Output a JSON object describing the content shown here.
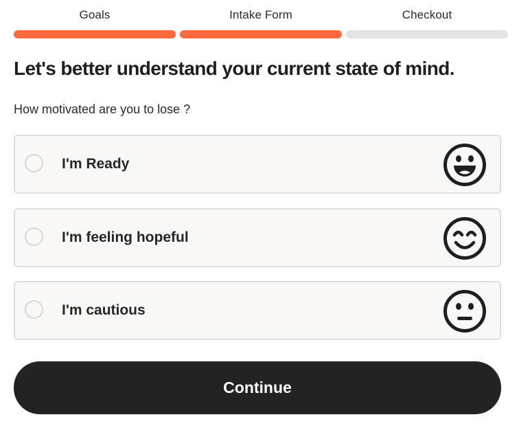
{
  "steps": [
    {
      "label": "Goals",
      "complete": true
    },
    {
      "label": "Intake Form",
      "complete": true
    },
    {
      "label": "Checkout",
      "complete": false
    }
  ],
  "colors": {
    "progress_done": "#ff6a3d",
    "progress_todo": "#e4e4e4",
    "button_bg": "#232323",
    "option_bg": "#f9f8f6"
  },
  "heading": "Let's better understand your current state of mind.",
  "question": "How motivated are you to lose ?",
  "options": [
    {
      "label": "I'm Ready",
      "icon": "grinning-face-icon",
      "selected": false
    },
    {
      "label": "I'm feeling hopeful",
      "icon": "smiling-face-icon",
      "selected": false
    },
    {
      "label": "I'm cautious",
      "icon": "neutral-face-icon",
      "selected": false
    }
  ],
  "continue_label": "Continue"
}
